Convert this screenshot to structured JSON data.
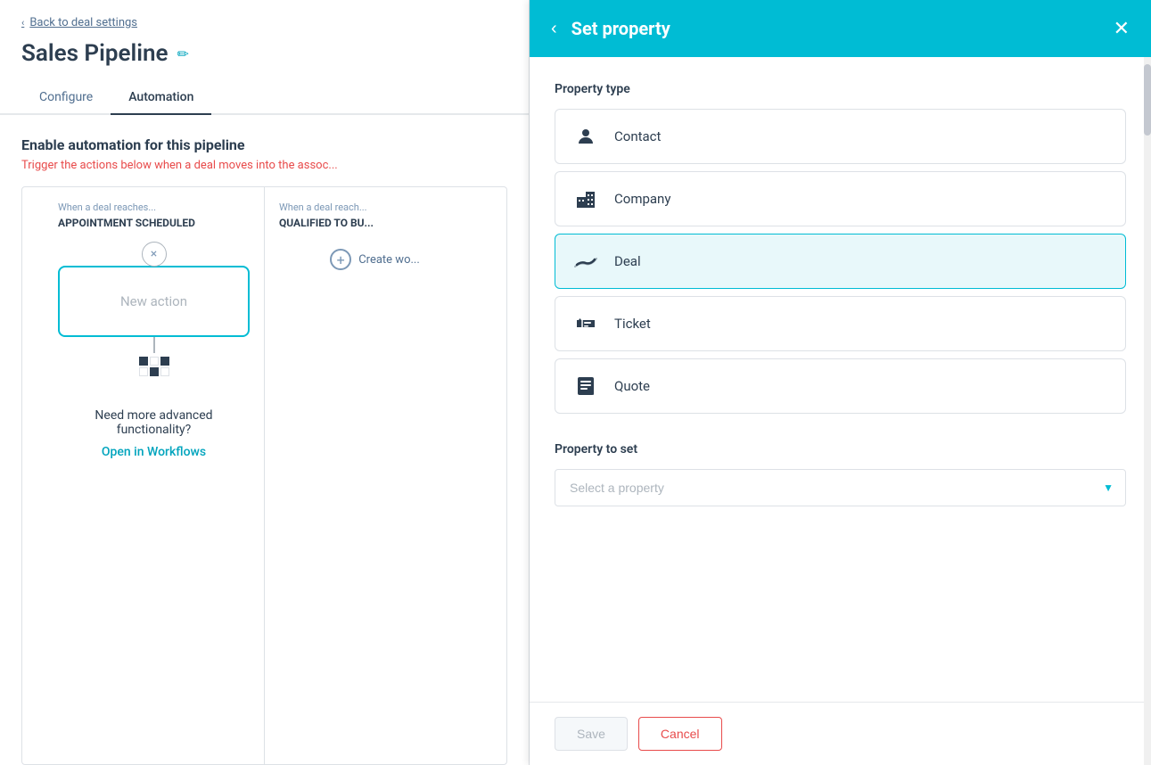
{
  "left": {
    "back_link": "Back to deal settings",
    "page_title": "Sales Pipeline",
    "edit_icon": "✏",
    "tabs": [
      {
        "label": "Configure",
        "active": false
      },
      {
        "label": "Automation",
        "active": true
      }
    ],
    "automation_title": "Enable automation for this pipeline",
    "automation_subtitle": "Trigger the actions below when a deal moves into the assoc...",
    "col1": {
      "label": "When a deal reaches...",
      "stage": "APPOINTMENT SCHEDULED",
      "new_action_label": "New action",
      "close_label": "×"
    },
    "col2": {
      "label": "When a deal reach...",
      "stage": "QUALIFIED TO BU..."
    },
    "create_workflow_label": "Create wo...",
    "advanced_text": "Need more advanced functionality?",
    "open_workflows_label": "Open in Workflows"
  },
  "right": {
    "back_label": "‹",
    "title": "Set property",
    "close_label": "✕",
    "property_type_label": "Property type",
    "items": [
      {
        "id": "contact",
        "label": "Contact",
        "icon": "contact",
        "selected": false
      },
      {
        "id": "company",
        "label": "Company",
        "icon": "company",
        "selected": false
      },
      {
        "id": "deal",
        "label": "Deal",
        "icon": "deal",
        "selected": true
      },
      {
        "id": "ticket",
        "label": "Ticket",
        "icon": "ticket",
        "selected": false
      },
      {
        "id": "quote",
        "label": "Quote",
        "icon": "quote",
        "selected": false
      }
    ],
    "property_to_set_label": "Property to set",
    "select_placeholder": "Select a property",
    "save_label": "Save",
    "cancel_label": "Cancel"
  }
}
